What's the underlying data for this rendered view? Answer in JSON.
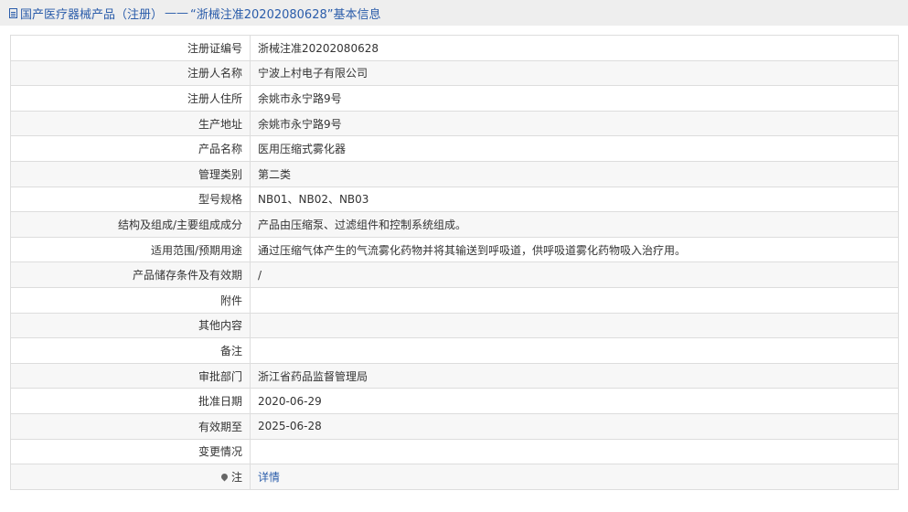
{
  "header": {
    "category": "国产医疗器械产品（注册）",
    "dash": "——",
    "title": "“浙械注准20202080628”基本信息"
  },
  "rows": [
    {
      "label": "注册证编号",
      "value": "浙械注准20202080628"
    },
    {
      "label": "注册人名称",
      "value": "宁波上村电子有限公司"
    },
    {
      "label": "注册人住所",
      "value": "余姚市永宁路9号"
    },
    {
      "label": "生产地址",
      "value": "余姚市永宁路9号"
    },
    {
      "label": "产品名称",
      "value": "医用压缩式雾化器"
    },
    {
      "label": "管理类别",
      "value": "第二类"
    },
    {
      "label": "型号规格",
      "value": "NB01、NB02、NB03"
    },
    {
      "label": "结构及组成/主要组成成分",
      "value": "产品由压缩泵、过滤组件和控制系统组成。"
    },
    {
      "label": "适用范围/预期用途",
      "value": "通过压缩气体产生的气流雾化药物并将其输送到呼吸道，供呼吸道雾化药物吸入治疗用。"
    },
    {
      "label": "产品储存条件及有效期",
      "value": "/"
    },
    {
      "label": "附件",
      "value": ""
    },
    {
      "label": "其他内容",
      "value": ""
    },
    {
      "label": "备注",
      "value": ""
    },
    {
      "label": "审批部门",
      "value": "浙江省药品监督管理局"
    },
    {
      "label": "批准日期",
      "value": "2020-06-29"
    },
    {
      "label": "有效期至",
      "value": "2025-06-28"
    },
    {
      "label": "变更情况",
      "value": ""
    }
  ],
  "note": {
    "label": "注",
    "link": "详情"
  },
  "icons": {
    "title": "document-icon",
    "note": "pin-icon"
  },
  "colors": {
    "link": "#2a5caa",
    "header_bg": "#eeeeee",
    "border": "#dddddd"
  }
}
